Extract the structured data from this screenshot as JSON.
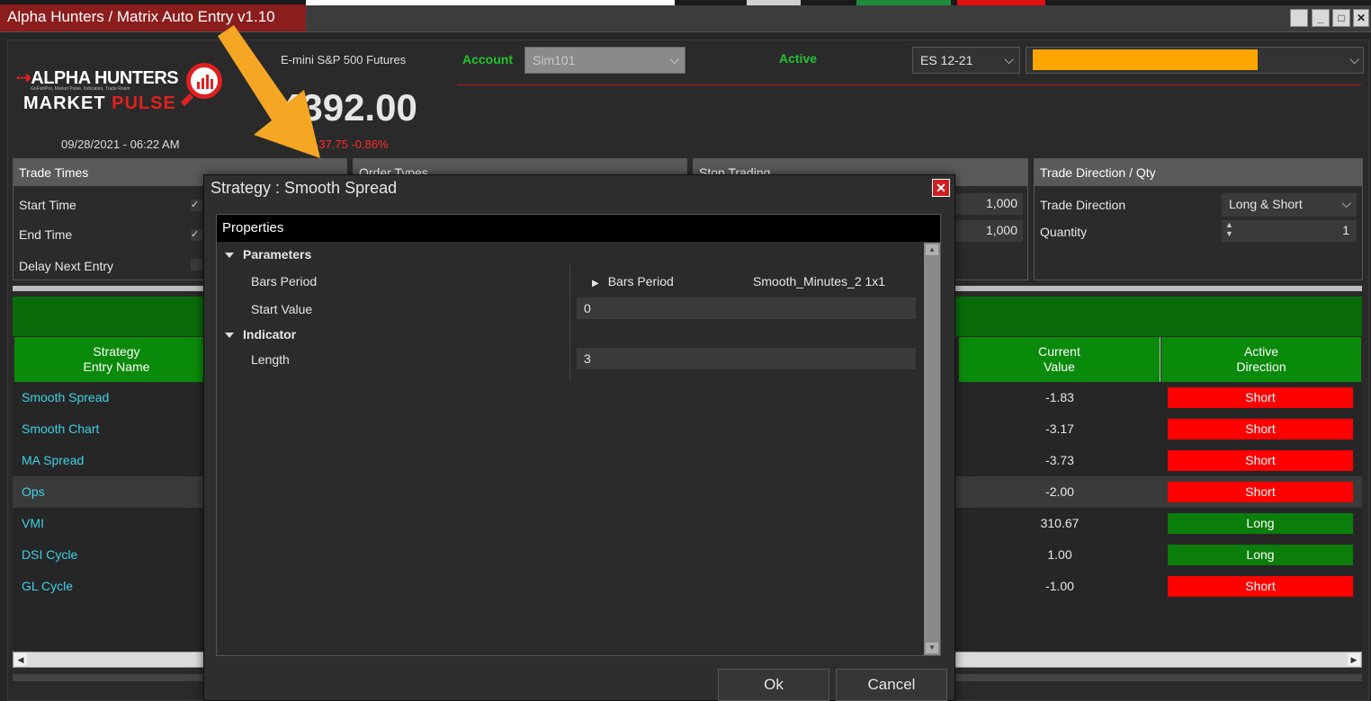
{
  "window": {
    "title": "Alpha Hunters / Matrix Auto Entry v1.10",
    "controls": [
      "restore-icon",
      "minimize-icon",
      "maximize-icon",
      "close-icon"
    ]
  },
  "header": {
    "logo": {
      "line1": "ALPHA HUNTERS",
      "subtitle": "GoFishPro, Market Pulse, Indicators, Trade Room",
      "line2_a": "MARKET",
      "line2_b": "PULSE"
    },
    "datetime": "09/28/2021 - 06:22 AM",
    "instrument_name": "E-mini S&P 500 Futures",
    "price": "4392.00",
    "change": "-37.75 -0.86%",
    "account_label": "Account",
    "account_value": "Sim101",
    "status_label": "Active",
    "instrument_select": "ES 12-21",
    "connection_color": "#ffa500"
  },
  "panels": {
    "trade_times": {
      "title": "Trade Times",
      "start_time": "Start Time",
      "end_time": "End Time",
      "delay_next_entry": "Delay Next Entry"
    },
    "order_types": {
      "title": "Order Types"
    },
    "stop_trading": {
      "title": "Stop Trading",
      "value1": "1,000",
      "value2": "1,000"
    },
    "trade_direction": {
      "title": "Trade Direction / Qty",
      "direction_label": "Trade Direction",
      "direction_value": "Long & Short",
      "quantity_label": "Quantity",
      "quantity_value": "1"
    }
  },
  "grid": {
    "headers": {
      "strategy_line1": "Strategy",
      "strategy_line2": "Entry Name",
      "current_line1": "Current",
      "current_line2": "Value",
      "active_line1": "Active",
      "active_line2": "Direction"
    },
    "rows": [
      {
        "name": "Smooth Spread",
        "value": "-1.83",
        "direction": "Short"
      },
      {
        "name": "Smooth Chart",
        "value": "-3.17",
        "direction": "Short"
      },
      {
        "name": "MA Spread",
        "value": "-3.73",
        "direction": "Short"
      },
      {
        "name": "Ops",
        "value": "-2.00",
        "direction": "Short"
      },
      {
        "name": "VMI",
        "value": "310.67",
        "direction": "Long"
      },
      {
        "name": "DSI Cycle",
        "value": "1.00",
        "direction": "Long"
      },
      {
        "name": "GL Cycle",
        "value": "-1.00",
        "direction": "Short"
      }
    ],
    "colors": {
      "short": "#ff0000",
      "long": "#0a7d0a",
      "name": "#3fd0e6"
    }
  },
  "dialog": {
    "title": "Strategy : Smooth Spread",
    "properties_label": "Properties",
    "sections": {
      "parameters": "Parameters",
      "indicator": "Indicator"
    },
    "props": {
      "bars_period_label": "Bars Period",
      "bars_period_sub": "Bars Period",
      "bars_period_value": "Smooth_Minutes_2 1x1",
      "start_value_label": "Start Value",
      "start_value": "0",
      "length_label": "Length",
      "length_value": "3"
    },
    "ok_label": "Ok",
    "cancel_label": "Cancel"
  },
  "overlay": {
    "arrow_color": "#f5a623"
  }
}
